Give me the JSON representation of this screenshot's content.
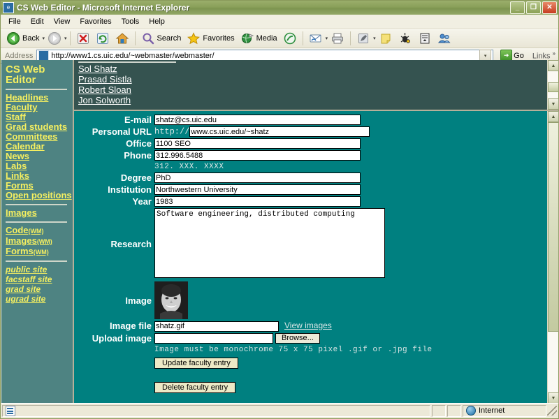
{
  "window": {
    "title": "CS Web Editor - Microsoft Internet Explorer",
    "minimize_label": "_",
    "maximize_label": "❐",
    "close_label": "✕"
  },
  "menu": {
    "items": [
      "File",
      "Edit",
      "View",
      "Favorites",
      "Tools",
      "Help"
    ]
  },
  "toolbar": {
    "back_label": "Back",
    "search_label": "Search",
    "favorites_label": "Favorites",
    "media_label": "Media",
    "caret": "▾"
  },
  "address": {
    "label": "Address",
    "url": "http://www1.cs.uic.edu/~webmaster/webmaster/",
    "go_label": "Go",
    "go_arrow": "➜",
    "links_label": "Links",
    "links_chevron": "»",
    "dropdown_caret": "▾"
  },
  "sidebar": {
    "title": "CS Web Editor",
    "group1": [
      {
        "label": "Headlines"
      },
      {
        "label": "Faculty"
      },
      {
        "label": "Staff"
      },
      {
        "label": "Grad students"
      },
      {
        "label": "Committees"
      },
      {
        "label": "Calendar"
      },
      {
        "label": "News"
      },
      {
        "label": "Labs"
      },
      {
        "label": "Links"
      },
      {
        "label": "Forms"
      },
      {
        "label": "Open positions"
      }
    ],
    "group2": [
      {
        "label": "Images"
      }
    ],
    "group3": [
      {
        "label": "Code",
        "suffix": "(WM)"
      },
      {
        "label": "Images",
        "suffix": "(WM)"
      },
      {
        "label": "Forms",
        "suffix": "(WM)"
      }
    ],
    "group4": [
      {
        "label": "public site"
      },
      {
        "label": "facstaff site"
      },
      {
        "label": "grad site"
      },
      {
        "label": "ugrad site"
      }
    ]
  },
  "top_frame": {
    "links": [
      "Sol Shatz",
      "Prasad Sistla",
      "Robert Sloan",
      "Jon Solworth"
    ]
  },
  "form": {
    "email": {
      "label": "E-mail",
      "value": "shatz@cs.uic.edu"
    },
    "personal_url": {
      "label": "Personal URL",
      "protocol": "http://",
      "value": "www.cs.uic.edu/~shatz"
    },
    "office": {
      "label": "Office",
      "value": "1100 SEO"
    },
    "phone": {
      "label": "Phone",
      "value": "312.996.5488",
      "hint": "312. XXX. XXXX"
    },
    "degree": {
      "label": "Degree",
      "value": "PhD"
    },
    "institution": {
      "label": "Institution",
      "value": "Northwestern University"
    },
    "year": {
      "label": "Year",
      "value": "1983"
    },
    "research": {
      "label": "Research",
      "value": "Software engineering, distributed computing"
    },
    "image": {
      "label": "Image"
    },
    "image_file": {
      "label": "Image file",
      "value": "shatz.gif",
      "view_link": "View images"
    },
    "upload_image": {
      "label": "Upload image",
      "value": "",
      "browse_label": "Browse..."
    },
    "upload_hint": "Image must be monochrome 75 x 75 pixel .gif or .jpg file",
    "update_button": "Update faculty entry",
    "delete_button": "Delete faculty entry"
  },
  "scrollbar": {
    "up_arrow": "▲",
    "down_arrow": "▼"
  },
  "statusbar": {
    "message": "",
    "zone": "Internet"
  },
  "colors": {
    "main_bg": "#008080",
    "top_frame_bg": "#355350",
    "sidebar_bg": "#4e8382",
    "link_yellow": "#f5ef60",
    "titlebar": "#8aa05a"
  }
}
